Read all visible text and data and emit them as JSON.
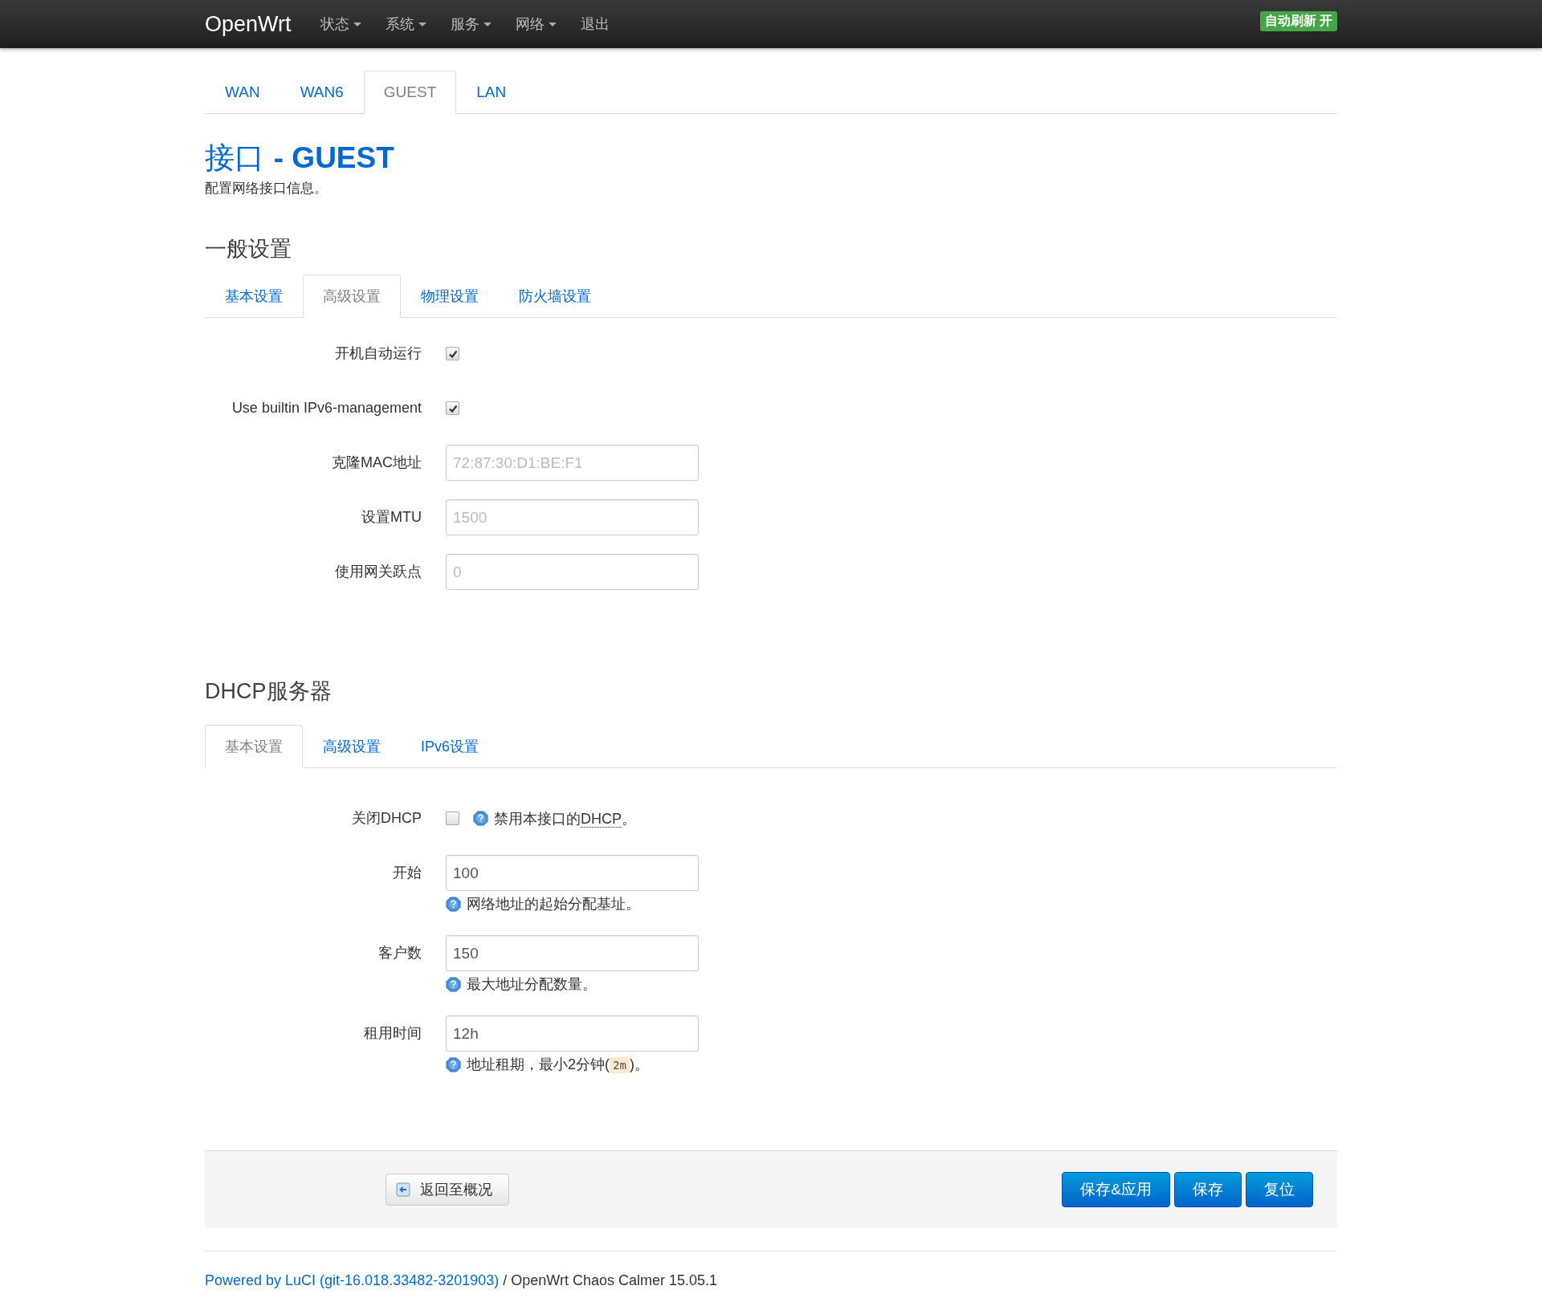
{
  "navbar": {
    "brand": "OpenWrt",
    "menus": [
      {
        "label": "状态",
        "dropdown": true
      },
      {
        "label": "系统",
        "dropdown": true
      },
      {
        "label": "服务",
        "dropdown": true
      },
      {
        "label": "网络",
        "dropdown": true
      },
      {
        "label": "退出",
        "dropdown": false
      }
    ],
    "badge": "自动刷新 开"
  },
  "interface_tabs": [
    {
      "label": "WAN",
      "selected": false
    },
    {
      "label": "WAN6",
      "selected": false
    },
    {
      "label": "GUEST",
      "selected": true
    },
    {
      "label": "LAN",
      "selected": false
    }
  ],
  "title": "接口 **- GUEST**",
  "description": "配置网络接口信息。",
  "sections": [
    {
      "title": "一般设置",
      "tabs": [
        {
          "label": "基本设置",
          "selected": false
        },
        {
          "label": "高级设置",
          "selected": true
        },
        {
          "label": "物理设置",
          "selected": false
        },
        {
          "label": "防火墙设置",
          "selected": false
        }
      ],
      "fields": [
        {
          "kind": "checkbox",
          "label": "开机自动运行",
          "checked": true
        },
        {
          "kind": "checkbox",
          "label": "Use builtin IPv6-management",
          "checked": true
        },
        {
          "kind": "text",
          "label": "克隆MAC地址",
          "placeholder": "72:87:30:D1:BE:F1"
        },
        {
          "kind": "text",
          "label": "设置MTU",
          "placeholder": "1500"
        },
        {
          "kind": "text",
          "label": "使用网关跃点",
          "placeholder": "0"
        }
      ]
    },
    {
      "title": "DHCP服务器",
      "tabs": [
        {
          "label": "基本设置",
          "selected": true
        },
        {
          "label": "高级设置",
          "selected": false
        },
        {
          "label": "IPv6设置",
          "selected": false
        }
      ],
      "fields": [
        {
          "kind": "checkbox",
          "label": "关闭DHCP",
          "checked": false,
          "help": [
            {
              "kind": "plain",
              "text": "禁用本接口的"
            },
            {
              "kind": "abbr",
              "text": "DHCP"
            },
            {
              "kind": "plain",
              "text": "。"
            }
          ]
        },
        {
          "kind": "text",
          "label": "开始",
          "value": "100",
          "help": [
            {
              "kind": "plain",
              "text": "网络地址的起始分配基址。"
            }
          ]
        },
        {
          "kind": "text",
          "label": "客户数",
          "value": "150",
          "help": [
            {
              "kind": "plain",
              "text": "最大地址分配数量。"
            }
          ]
        },
        {
          "kind": "text",
          "label": "租用时间",
          "value": "12h",
          "help": [
            {
              "kind": "plain",
              "text": "地址租期，最小2分钟("
            },
            {
              "kind": "code",
              "text": "2m"
            },
            {
              "kind": "plain",
              "text": ")。"
            }
          ]
        }
      ]
    }
  ],
  "actions": {
    "back": "返回至概况",
    "buttons": [
      "保存&应用",
      "保存",
      "复位"
    ]
  },
  "footer": {
    "link": "Powered by LuCI (git-16.018.33482-3201903)",
    "text": "/ OpenWrt Chaos Calmer 15.05.1"
  }
}
